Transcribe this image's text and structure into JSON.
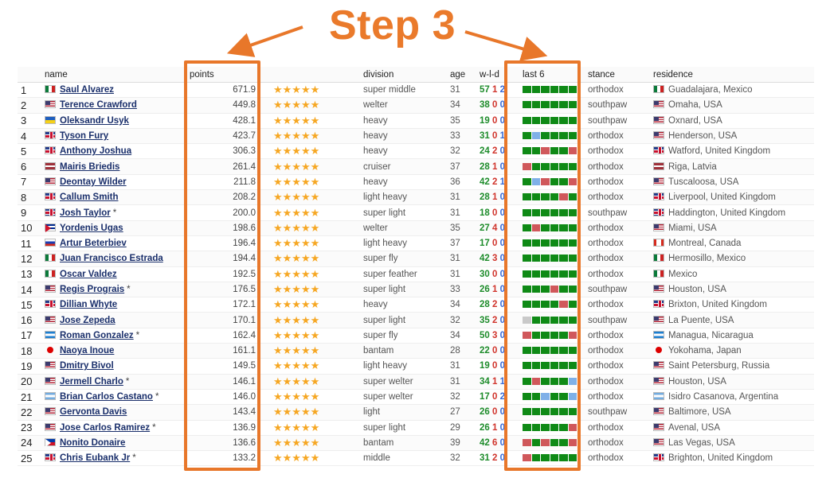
{
  "annotation": {
    "title": "Step 3"
  },
  "colors": {
    "accent": "#e8772a",
    "win": "#0f8a16",
    "loss": "#d0585b",
    "draw": "#7fb0e8"
  },
  "table": {
    "headers": {
      "name": "name",
      "points": "points",
      "division": "division",
      "age": "age",
      "wld": "w-l-d",
      "last6": "last 6",
      "stance": "stance",
      "residence": "residence"
    },
    "rows": [
      {
        "rank": "1",
        "flag": "mx",
        "name": "Saul Alvarez",
        "mark": "",
        "points": "671.9",
        "division": "super middle",
        "age": "31",
        "w": "57",
        "l": "1",
        "d": "2",
        "last6": "WWWWWW",
        "stance": "orthodox",
        "res_flag": "mx",
        "residence": "Guadalajara, Mexico"
      },
      {
        "rank": "2",
        "flag": "us",
        "name": "Terence Crawford",
        "mark": "",
        "points": "449.8",
        "division": "welter",
        "age": "34",
        "w": "38",
        "l": "0",
        "d": "0",
        "last6": "WWWWWW",
        "stance": "southpaw",
        "res_flag": "us",
        "residence": "Omaha, USA"
      },
      {
        "rank": "3",
        "flag": "ua",
        "name": "Oleksandr Usyk",
        "mark": "",
        "points": "428.1",
        "division": "heavy",
        "age": "35",
        "w": "19",
        "l": "0",
        "d": "0",
        "last6": "WWWWWW",
        "stance": "southpaw",
        "res_flag": "us",
        "residence": "Oxnard, USA"
      },
      {
        "rank": "4",
        "flag": "gb",
        "name": "Tyson Fury",
        "mark": "",
        "points": "423.7",
        "division": "heavy",
        "age": "33",
        "w": "31",
        "l": "0",
        "d": "1",
        "last6": "WDWWWW",
        "stance": "orthodox",
        "res_flag": "us",
        "residence": "Henderson, USA"
      },
      {
        "rank": "5",
        "flag": "gb",
        "name": "Anthony Joshua",
        "mark": "",
        "points": "306.3",
        "division": "heavy",
        "age": "32",
        "w": "24",
        "l": "2",
        "d": "0",
        "last6": "WWLWWL",
        "stance": "orthodox",
        "res_flag": "gb",
        "residence": "Watford, United Kingdom"
      },
      {
        "rank": "6",
        "flag": "lv",
        "name": "Mairis Briedis",
        "mark": "",
        "points": "261.4",
        "division": "cruiser",
        "age": "37",
        "w": "28",
        "l": "1",
        "d": "0",
        "last6": "LWWWWW",
        "stance": "orthodox",
        "res_flag": "lv",
        "residence": "Riga, Latvia"
      },
      {
        "rank": "7",
        "flag": "us",
        "name": "Deontay Wilder",
        "mark": "",
        "points": "211.8",
        "division": "heavy",
        "age": "36",
        "w": "42",
        "l": "2",
        "d": "1",
        "last6": "WDLWWL",
        "stance": "orthodox",
        "res_flag": "us",
        "residence": "Tuscaloosa, USA"
      },
      {
        "rank": "8",
        "flag": "gb",
        "name": "Callum Smith",
        "mark": "",
        "points": "208.2",
        "division": "light heavy",
        "age": "31",
        "w": "28",
        "l": "1",
        "d": "0",
        "last6": "WWWWLW",
        "stance": "orthodox",
        "res_flag": "gb",
        "residence": "Liverpool, United Kingdom"
      },
      {
        "rank": "9",
        "flag": "gb",
        "name": "Josh Taylor",
        "mark": "*",
        "points": "200.0",
        "division": "super light",
        "age": "31",
        "w": "18",
        "l": "0",
        "d": "0",
        "last6": "WWWWWW",
        "stance": "southpaw",
        "res_flag": "gb",
        "residence": "Haddington, United Kingdom"
      },
      {
        "rank": "10",
        "flag": "cu",
        "name": "Yordenis Ugas",
        "mark": "",
        "points": "198.6",
        "division": "welter",
        "age": "35",
        "w": "27",
        "l": "4",
        "d": "0",
        "last6": "WLWWWW",
        "stance": "orthodox",
        "res_flag": "us",
        "residence": "Miami, USA"
      },
      {
        "rank": "11",
        "flag": "ru",
        "name": "Artur Beterbiev",
        "mark": "",
        "points": "196.4",
        "division": "light heavy",
        "age": "37",
        "w": "17",
        "l": "0",
        "d": "0",
        "last6": "WWWWWW",
        "stance": "orthodox",
        "res_flag": "ca",
        "residence": "Montreal, Canada"
      },
      {
        "rank": "12",
        "flag": "mx",
        "name": "Juan Francisco Estrada",
        "mark": "",
        "points": "194.4",
        "division": "super fly",
        "age": "31",
        "w": "42",
        "l": "3",
        "d": "0",
        "last6": "WWWWWW",
        "stance": "orthodox",
        "res_flag": "mx",
        "residence": "Hermosillo, Mexico"
      },
      {
        "rank": "13",
        "flag": "mx",
        "name": "Oscar Valdez",
        "mark": "",
        "points": "192.5",
        "division": "super feather",
        "age": "31",
        "w": "30",
        "l": "0",
        "d": "0",
        "last6": "WWWWWW",
        "stance": "orthodox",
        "res_flag": "mx",
        "residence": "Mexico"
      },
      {
        "rank": "14",
        "flag": "us",
        "name": "Regis Prograis",
        "mark": "*",
        "points": "176.5",
        "division": "super light",
        "age": "33",
        "w": "26",
        "l": "1",
        "d": "0",
        "last6": "WWWLWW",
        "stance": "southpaw",
        "res_flag": "us",
        "residence": "Houston, USA"
      },
      {
        "rank": "15",
        "flag": "gb",
        "name": "Dillian Whyte",
        "mark": "",
        "points": "172.1",
        "division": "heavy",
        "age": "34",
        "w": "28",
        "l": "2",
        "d": "0",
        "last6": "WWWWLW",
        "stance": "orthodox",
        "res_flag": "gb",
        "residence": "Brixton, United Kingdom"
      },
      {
        "rank": "16",
        "flag": "us",
        "name": "Jose Zepeda",
        "mark": "",
        "points": "170.1",
        "division": "super light",
        "age": "32",
        "w": "35",
        "l": "2",
        "d": "0",
        "last6": "NWWWWW",
        "stance": "southpaw",
        "res_flag": "us",
        "residence": "La Puente, USA"
      },
      {
        "rank": "17",
        "flag": "hn",
        "name": "Roman Gonzalez",
        "mark": "*",
        "points": "162.4",
        "division": "super fly",
        "age": "34",
        "w": "50",
        "l": "3",
        "d": "0",
        "last6": "LWWWWL",
        "stance": "orthodox",
        "res_flag": "hn",
        "residence": "Managua, Nicaragua"
      },
      {
        "rank": "18",
        "flag": "jp",
        "name": "Naoya Inoue",
        "mark": "",
        "points": "161.1",
        "division": "bantam",
        "age": "28",
        "w": "22",
        "l": "0",
        "d": "0",
        "last6": "WWWWWW",
        "stance": "orthodox",
        "res_flag": "jp",
        "residence": "Yokohama, Japan"
      },
      {
        "rank": "19",
        "flag": "us",
        "name": "Dmitry Bivol",
        "mark": "",
        "points": "149.5",
        "division": "light heavy",
        "age": "31",
        "w": "19",
        "l": "0",
        "d": "0",
        "last6": "WWWWWW",
        "stance": "orthodox",
        "res_flag": "us",
        "residence": "Saint Petersburg, Russia"
      },
      {
        "rank": "20",
        "flag": "us",
        "name": "Jermell Charlo",
        "mark": "*",
        "points": "146.1",
        "division": "super welter",
        "age": "31",
        "w": "34",
        "l": "1",
        "d": "1",
        "last6": "WLWWWD",
        "stance": "orthodox",
        "res_flag": "us",
        "residence": "Houston, USA"
      },
      {
        "rank": "21",
        "flag": "ar",
        "name": "Brian Carlos Castano",
        "mark": "*",
        "points": "146.0",
        "division": "super welter",
        "age": "32",
        "w": "17",
        "l": "0",
        "d": "2",
        "last6": "WWDWWD",
        "stance": "orthodox",
        "res_flag": "ar",
        "residence": "Isidro Casanova, Argentina"
      },
      {
        "rank": "22",
        "flag": "us",
        "name": "Gervonta Davis",
        "mark": "",
        "points": "143.4",
        "division": "light",
        "age": "27",
        "w": "26",
        "l": "0",
        "d": "0",
        "last6": "WWWWWW",
        "stance": "southpaw",
        "res_flag": "us",
        "residence": "Baltimore, USA"
      },
      {
        "rank": "23",
        "flag": "us",
        "name": "Jose Carlos Ramirez",
        "mark": "*",
        "points": "136.9",
        "division": "super light",
        "age": "29",
        "w": "26",
        "l": "1",
        "d": "0",
        "last6": "WWWWWL",
        "stance": "orthodox",
        "res_flag": "us",
        "residence": "Avenal, USA"
      },
      {
        "rank": "24",
        "flag": "ph",
        "name": "Nonito Donaire",
        "mark": "",
        "points": "136.6",
        "division": "bantam",
        "age": "39",
        "w": "42",
        "l": "6",
        "d": "0",
        "last6": "LWLWWL",
        "stance": "orthodox",
        "res_flag": "us",
        "residence": "Las Vegas, USA"
      },
      {
        "rank": "25",
        "flag": "gb",
        "name": "Chris Eubank Jr",
        "mark": "*",
        "points": "133.2",
        "division": "middle",
        "age": "32",
        "w": "31",
        "l": "2",
        "d": "0",
        "last6": "LWWWWW",
        "stance": "orthodox",
        "res_flag": "gb",
        "residence": "Brighton, United Kingdom"
      }
    ]
  }
}
